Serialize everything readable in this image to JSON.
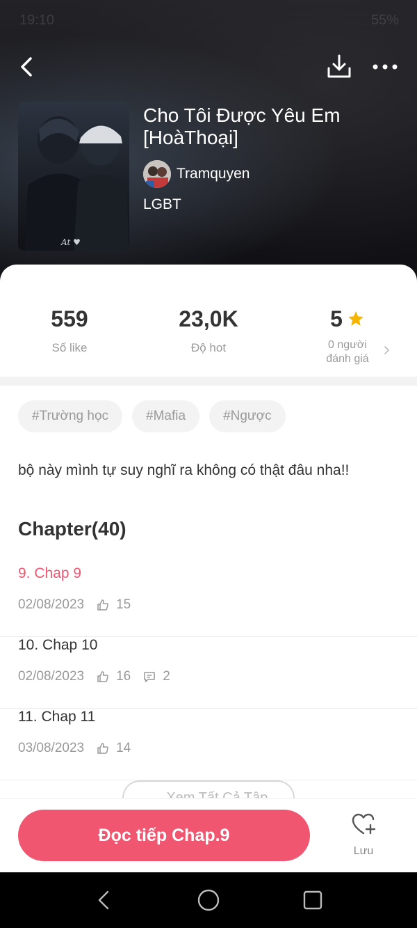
{
  "status_bar": {
    "time": "19:10",
    "battery": "55%"
  },
  "header": {
    "title": "Cho Tôi Được Yêu Em [HoàThoại]",
    "author": "Tramquyen",
    "genre": "LGBT"
  },
  "stats": {
    "likes_value": "559",
    "likes_label": "Số like",
    "hot_value": "23,0K",
    "hot_label": "Độ hot",
    "rating_value": "5",
    "rating_label_line1": "0 người",
    "rating_label_line2": "đánh giá"
  },
  "tags": [
    "#Trường học",
    "#Mafia",
    "#Ngược"
  ],
  "description": "bộ này mình tự suy nghĩ ra không có thật đâu nha!!",
  "chapters": {
    "heading": "Chapter(40)",
    "items": [
      {
        "title": "9. Chap 9",
        "date": "02/08/2023",
        "likes": "15",
        "comments": ""
      },
      {
        "title": "10. Chap 10",
        "date": "02/08/2023",
        "likes": "16",
        "comments": "2"
      },
      {
        "title": "11. Chap 11",
        "date": "03/08/2023",
        "likes": "14",
        "comments": ""
      }
    ],
    "see_all_label": "Xem Tất Cả Tập"
  },
  "bottom": {
    "read_button": "Đọc tiếp Chap.9",
    "save_label": "Lưu"
  },
  "colors": {
    "accent": "#f0566f",
    "star": "#f5b400",
    "hero_bg": "#141418"
  }
}
